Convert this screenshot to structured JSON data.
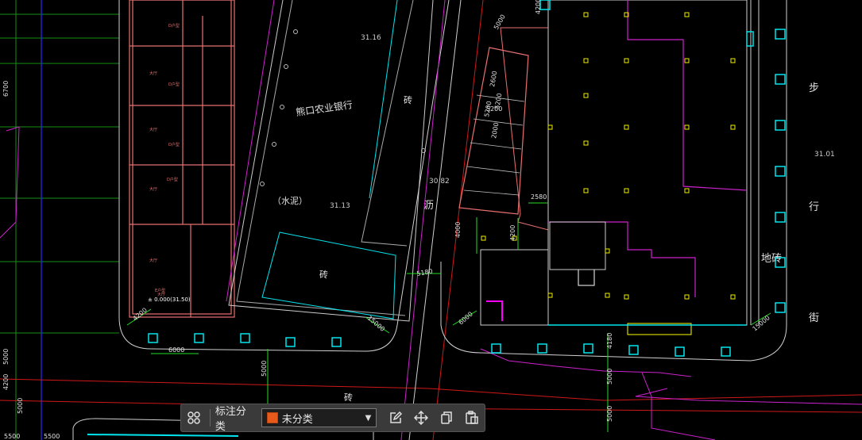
{
  "drawing": {
    "bank_label": "熊口农业银行",
    "cement_label": "（水泥）",
    "brick_labels": [
      "砖",
      "砖",
      "砖",
      "砖"
    ],
    "asphalt_label": "沥",
    "street_chars": [
      "步",
      "行",
      "地砖",
      "街"
    ],
    "elevations": [
      "31.16",
      "31.13",
      "30.82",
      "31.01"
    ],
    "room_labels": [
      "D户型",
      "D户型",
      "D户型",
      "D户型",
      "E户型",
      "大厅",
      "大厅",
      "大厅",
      "大厅",
      "大厅"
    ],
    "floor_level": "± 0.000(31.50)",
    "dimensions": [
      "6700",
      "5200",
      "5200",
      "5000",
      "2600",
      "5200",
      "2000",
      "2580",
      "4200",
      "4000",
      "4200",
      "5180",
      "6000",
      "15000",
      "15000",
      "4200",
      "6000",
      "4180",
      "5000",
      "5000",
      "5000",
      "4200",
      "5000",
      "5000",
      "5500",
      "5500"
    ]
  },
  "toolbar": {
    "label": "标注分类",
    "selected_category": "未分类",
    "category_color": "#e85a1c",
    "icons": [
      "grid-icon",
      "edit-icon",
      "move-icon",
      "copy-icon",
      "paste-icon"
    ]
  }
}
